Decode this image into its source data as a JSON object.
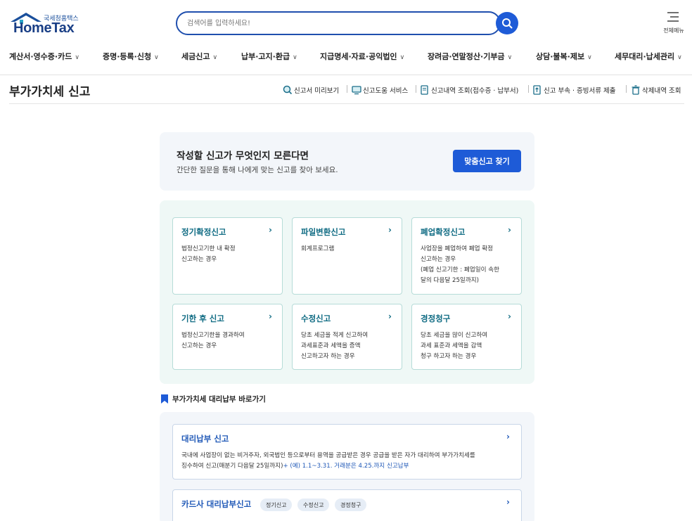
{
  "brand": {
    "logo_sub": "국세청홈택스",
    "logo_main": "HomeTax"
  },
  "search": {
    "placeholder": "검색어를 입력하세요!",
    "button_icon": "search-icon"
  },
  "all_menu": {
    "label": "전체메뉴",
    "icon": "hamburger-icon"
  },
  "gnb": {
    "items": [
      {
        "label": "계산서·영수증·카드"
      },
      {
        "label": "증명·등록·신청"
      },
      {
        "label": "세금신고"
      },
      {
        "label": "납부·고지·환급"
      },
      {
        "label": "지급명세·자료·공익법인"
      },
      {
        "label": "장려금·연말정산·기부금"
      },
      {
        "label": "상담·불복·제보"
      },
      {
        "label": "세무대리·납세관리"
      }
    ]
  },
  "page": {
    "title": "부가가치세 신고"
  },
  "quick_links": [
    {
      "label": "신고서 미리보기",
      "icon": "magnifier-doc-icon"
    },
    {
      "label": "신고도움 서비스",
      "icon": "monitor-help-icon"
    },
    {
      "label": "신고내역 조회(접수증 · 납부서)",
      "icon": "document-search-icon"
    },
    {
      "label": "신고 부속 · 증빙서류 제출",
      "icon": "document-upload-icon"
    },
    {
      "label": "삭제내역 조회",
      "icon": "trash-icon"
    }
  ],
  "find": {
    "title": "작성할 신고가 무엇인지 모른다면",
    "desc": "간단한 질문을 통해 나에게 맞는 신고를 찾아 보세요.",
    "button": "맞춤신고 찾기"
  },
  "cards": [
    {
      "title": "정기확정신고",
      "desc": [
        "법정신고기한 내 확정",
        "신고하는 경우"
      ]
    },
    {
      "title": "파일변환신고",
      "desc": [
        "회계프로그램"
      ]
    },
    {
      "title": "폐업확정신고",
      "desc": [
        "사업장을 폐업하여 폐업 확정",
        "신고하는 경우",
        "(폐업 신고기한 : 폐업일이 속한",
        "달의 다음달 25일까지)"
      ]
    },
    {
      "title": "기한 후 신고",
      "desc": [
        "법정신고기한을 경과하여",
        "신고하는 경우"
      ]
    },
    {
      "title": "수정신고",
      "desc": [
        "당초 세금을 적게 신고하여",
        "과세표준과 세액을 증액",
        "신고하고자 하는 경우"
      ]
    },
    {
      "title": "경정청구",
      "desc": [
        "당초 세금을 많이 신고하여",
        "과세 표준과 세액을 감액",
        "청구 하고자 하는 경우"
      ]
    }
  ],
  "card_arrow": "›",
  "proxy": {
    "section_title": "부가가치세 대리납부 바로가기",
    "cards": [
      {
        "title": "대리납부 신고",
        "desc_line1": "국내에 사업장이 없는 비거주자, 외국법인 등으로부터 용역을 공급받은 경우 공급을 받은 자가 대리하여 부가가치세를",
        "desc_line2": "징수하여 신고(매분기 다음달 25일까지)",
        "desc_highlight": "+ (예) 1.1~3.31. 거래분은 4.25.까지 신고납부"
      },
      {
        "title": "카드사 대리납부신고",
        "tags": [
          "정기신고",
          "수정신고",
          "경정청구"
        ]
      }
    ]
  },
  "colors": {
    "primary": "#1e5bd7",
    "teal": "#0f6b83",
    "panel_green": "#eff8f6",
    "panel_gray": "#f3f6fa"
  }
}
